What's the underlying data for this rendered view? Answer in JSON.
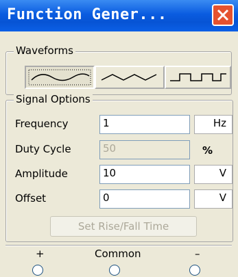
{
  "window": {
    "title": "Function Gener...",
    "close_icon": "close-icon"
  },
  "waveforms": {
    "legend": "Waveforms",
    "buttons": [
      {
        "name": "sine",
        "icon": "sine-wave-icon",
        "active": true
      },
      {
        "name": "triangle",
        "icon": "triangle-wave-icon",
        "active": false
      },
      {
        "name": "square",
        "icon": "square-wave-icon",
        "active": false
      }
    ]
  },
  "signal_options": {
    "legend": "Signal Options",
    "rows": [
      {
        "label": "Frequency",
        "value": "1",
        "unit": "Hz",
        "enabled": true
      },
      {
        "label": "Duty Cycle",
        "value": "50",
        "unit": "%",
        "enabled": false
      },
      {
        "label": "Amplitude",
        "value": "10",
        "unit": "V",
        "enabled": true
      },
      {
        "label": "Offset",
        "value": "0",
        "unit": "V",
        "enabled": true
      }
    ]
  },
  "set_rise_fall_label": "Set Rise/Fall Time",
  "terminals": [
    {
      "label": "+",
      "icon": "radio-button"
    },
    {
      "label": "Common",
      "icon": "radio-button"
    },
    {
      "label": "–",
      "icon": "radio-button"
    }
  ],
  "colors": {
    "titlebar": "#0a5ce0",
    "close": "#e5522f",
    "face": "#ece9d8"
  }
}
